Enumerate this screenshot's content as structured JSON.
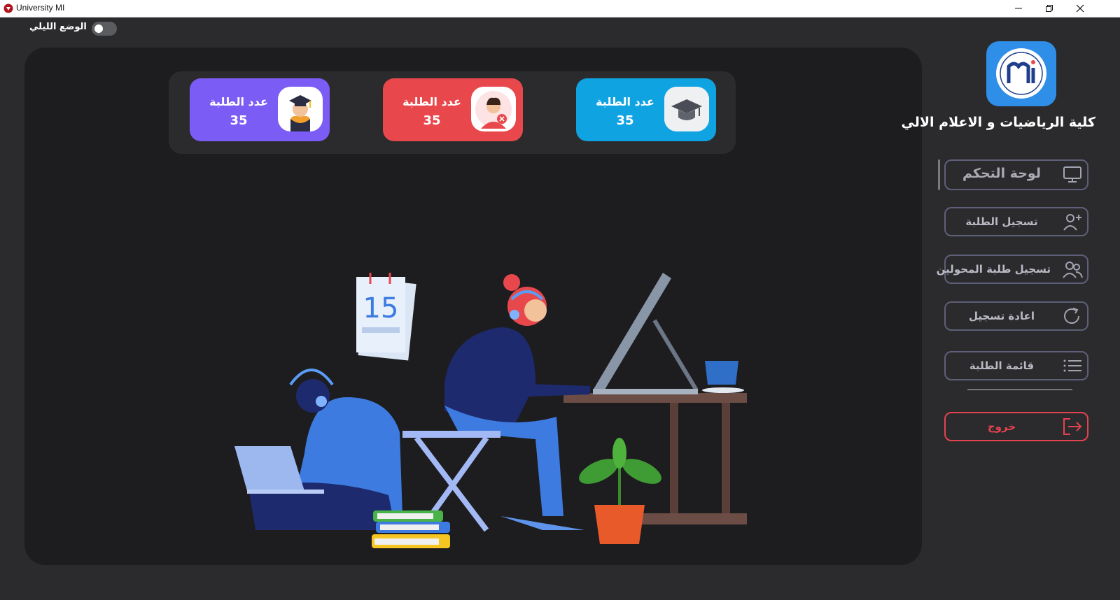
{
  "window": {
    "title": "University MI",
    "controls": [
      "minimize-icon",
      "restore-icon",
      "close-icon"
    ]
  },
  "night_mode": {
    "label": "الوضع الليلي",
    "enabled": false
  },
  "stats": [
    {
      "label": "عدد الطلبة",
      "value": "35",
      "color": "#7b5cf5",
      "icon": "graduate-icon"
    },
    {
      "label": "عدد الطلبة",
      "value": "35",
      "color": "#e8484c",
      "icon": "student-removed-icon"
    },
    {
      "label": "عدد الطلبة",
      "value": "35",
      "color": "#10a3e2",
      "icon": "graduation-cap-icon"
    }
  ],
  "sidebar": {
    "college_name": "كلية الرياضيات و الاعلام الالي",
    "items": [
      {
        "label": "لوحة التحكم",
        "icon": "monitor-icon",
        "active": true
      },
      {
        "label": "تسجيل الطلبة",
        "icon": "add-user-icon",
        "active": false
      },
      {
        "label": "تسجيل طلبة المحولين",
        "icon": "users-icon",
        "active": false
      },
      {
        "label": "اعادة تسجيل",
        "icon": "refresh-icon",
        "active": false
      },
      {
        "label": "قائمة الطلبة",
        "icon": "list-icon",
        "active": false
      }
    ],
    "exit_label": "خروج",
    "exit_icon": "logout-icon"
  },
  "illustration": {
    "calendar_day": "15"
  },
  "colors": {
    "background": "#2b2b2d",
    "panel": "#1d1d1f",
    "accent_purple": "#7b5cf5",
    "accent_red": "#e8484c",
    "accent_blue": "#10a3e2",
    "exit_red": "#e2434f"
  }
}
